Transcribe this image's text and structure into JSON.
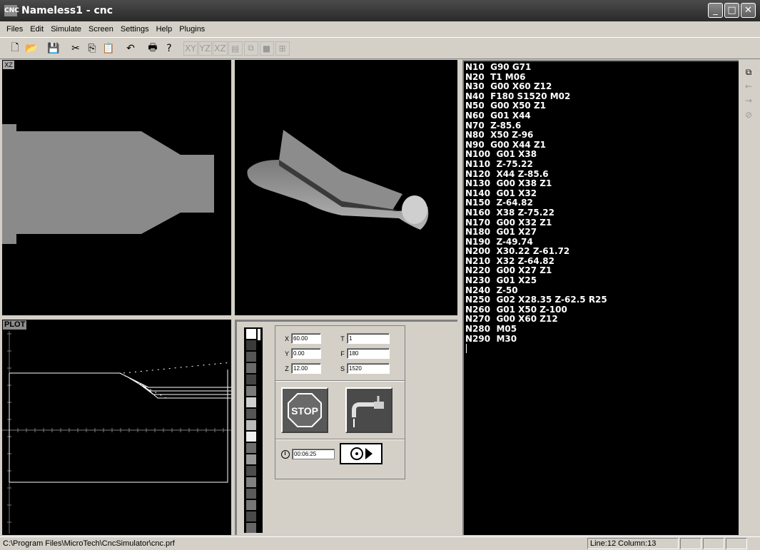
{
  "window": {
    "title": "Nameless1 - cnc",
    "icon_name": "cnc-app-icon",
    "app_icon_text": "CNC",
    "min_glyph": "_",
    "max_glyph": "□",
    "close_glyph": "✕"
  },
  "menu": [
    "Files",
    "Edit",
    "Simulate",
    "Screen",
    "Settings",
    "Help",
    "Plugins"
  ],
  "toolbar": {
    "icons": [
      "new-file-icon",
      "open-folder-icon",
      "save-icon",
      "cut-icon",
      "copy-icon",
      "paste-icon",
      "undo-icon",
      "print-icon",
      "help-icon"
    ],
    "glyphs": [
      "🗋",
      "📂",
      "💾",
      "✂",
      "⎘",
      "📋",
      "↶",
      "🖶",
      "?"
    ],
    "view_buttons": [
      "XY",
      "YZ",
      "XZ"
    ],
    "disabled_icons": [
      "grid-view-icon",
      "split-view-icon",
      "solid-view-icon",
      "fit-view-icon"
    ],
    "disabled_glyphs": [
      "▤",
      "⧉",
      "■",
      "⊞"
    ]
  },
  "views": {
    "xz_label": "XZ",
    "plot_label": "PLOT",
    "colors": {
      "workpiece": "#8a8a8a",
      "background": "#000000",
      "toolpath": "#ffffff"
    }
  },
  "control": {
    "readouts": [
      {
        "axis": "X",
        "value": "60.00"
      },
      {
        "axis": "Y",
        "value": "0.00"
      },
      {
        "axis": "Z",
        "value": "12.00"
      }
    ],
    "params": [
      {
        "label": "T",
        "value": "1"
      },
      {
        "label": "F",
        "value": "180"
      },
      {
        "label": "S",
        "value": "1520"
      }
    ],
    "stop_label": "STOP",
    "elapsed": "00:06:25",
    "tool_light_colors": [
      "#ffffff",
      "#3a3a3a",
      "#555555",
      "#6a6a6a",
      "#444444",
      "#7a7a7a",
      "#cfcfcf",
      "#555555",
      "#bbbbbb",
      "#eeeeee",
      "#6d6d6d",
      "#999999",
      "#4c4c4c",
      "#808080",
      "#5a5a5a",
      "#777777",
      "#4a4a4a",
      "#666666"
    ]
  },
  "program": [
    "N10  G90 G71",
    "N20  T1 M06",
    "N30  G00 X60 Z12",
    "N40  F180 S1520 M02",
    "N50  G00 X50 Z1",
    "N60  G01 X44",
    "N70  Z-85.6",
    "N80  X50 Z-96",
    "N90  G00 X44 Z1",
    "N100  G01 X38",
    "N110  Z-75.22",
    "N120  X44 Z-85.6",
    "N130  G00 X38 Z1",
    "N140  G01 X32",
    "N150  Z-64.82",
    "N160  X38 Z-75.22",
    "N170  G00 X32 Z1",
    "N180  G01 X27",
    "N190  Z-49.74",
    "N200  X30.22 Z-61.72",
    "N210  X32 Z-64.82",
    "N220  G00 X27 Z1",
    "N230  G01 X25",
    "N240  Z-50",
    "N250  G02 X28.35 Z-62.5 R25",
    "N260  G01 X50 Z-100",
    "N270  G00 X60 Z12",
    "N280  M05",
    "N290  M30"
  ],
  "side_tools": {
    "icons": [
      "copy-view-icon",
      "arrow-left-icon",
      "arrow-right-icon",
      "cancel-icon"
    ],
    "glyphs": [
      "⧉",
      "←",
      "→",
      "⊘"
    ]
  },
  "status": {
    "path": "C:\\Program Files\\MicroTech\\CncSimulator\\cnc.prf",
    "position": "Line:12 Column:13"
  }
}
